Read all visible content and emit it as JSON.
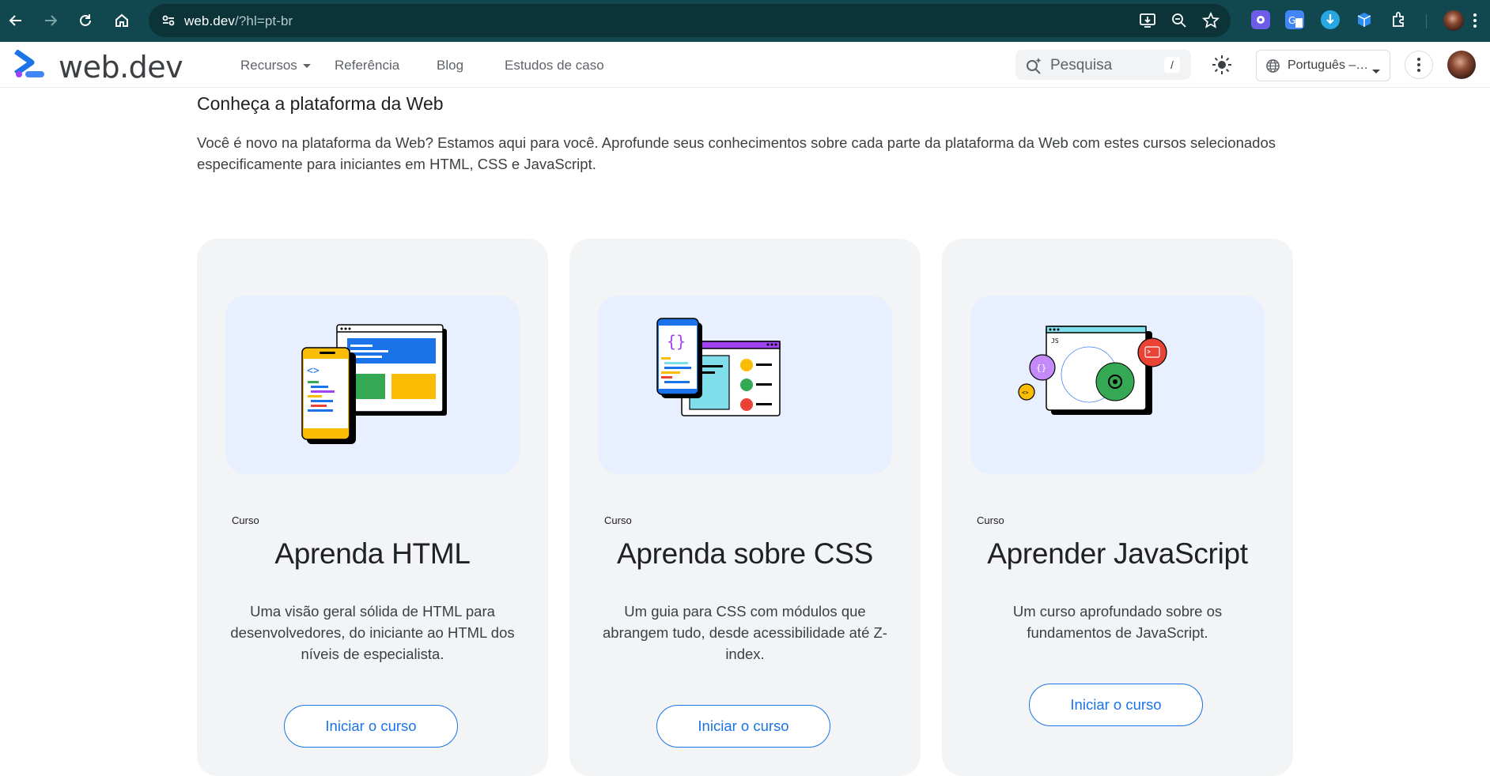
{
  "browser": {
    "url_host": "web.dev",
    "url_rest": "/?hl=pt-br"
  },
  "site": {
    "logo_text": "web.dev",
    "nav": [
      {
        "label": "Recursos"
      },
      {
        "label": "Referência"
      },
      {
        "label": "Blog"
      },
      {
        "label": "Estudos de caso"
      }
    ],
    "search_placeholder": "Pesquisa",
    "search_shortcut": "/",
    "language": "Português –…"
  },
  "main": {
    "section_title": "Conheça a plataforma da Web",
    "intro": "Você é novo na plataforma da Web? Estamos aqui para você. Aprofunde seus conhecimentos sobre cada parte da plataforma da Web com estes cursos selecionados especificamente para iniciantes em HTML, CSS e JavaScript.",
    "cards": [
      {
        "eyebrow": "Curso",
        "title": "Aprenda HTML",
        "description": "Uma visão geral sólida de HTML para desenvolvedores, do iniciante ao HTML dos níveis de especialista.",
        "cta": "Iniciar o curso"
      },
      {
        "eyebrow": "Curso",
        "title": "Aprenda sobre CSS",
        "description": "Um guia para CSS com módulos que abrangem tudo, desde acessibilidade até Z-index.",
        "cta": "Iniciar o curso"
      },
      {
        "eyebrow": "Curso",
        "title": "Aprender JavaScript",
        "description": "Um curso aprofundado sobre os fundamentos de JavaScript.",
        "cta": "Iniciar o curso"
      }
    ]
  },
  "colors": {
    "browser_bar": "#11474e",
    "accent": "#1a73e8",
    "card_bg": "#f3f4f5",
    "illustration_bg": "#e8efff"
  },
  "icons": [
    "back-arrow-icon",
    "forward-arrow-icon",
    "reload-icon",
    "home-icon",
    "site-settings-icon",
    "install-app-icon",
    "zoom-icon",
    "bookmark-star-icon",
    "extensions-icon",
    "webdev-logo-icon",
    "search-spark-icon",
    "theme-toggle-icon",
    "globe-icon",
    "more-vert-icon"
  ]
}
